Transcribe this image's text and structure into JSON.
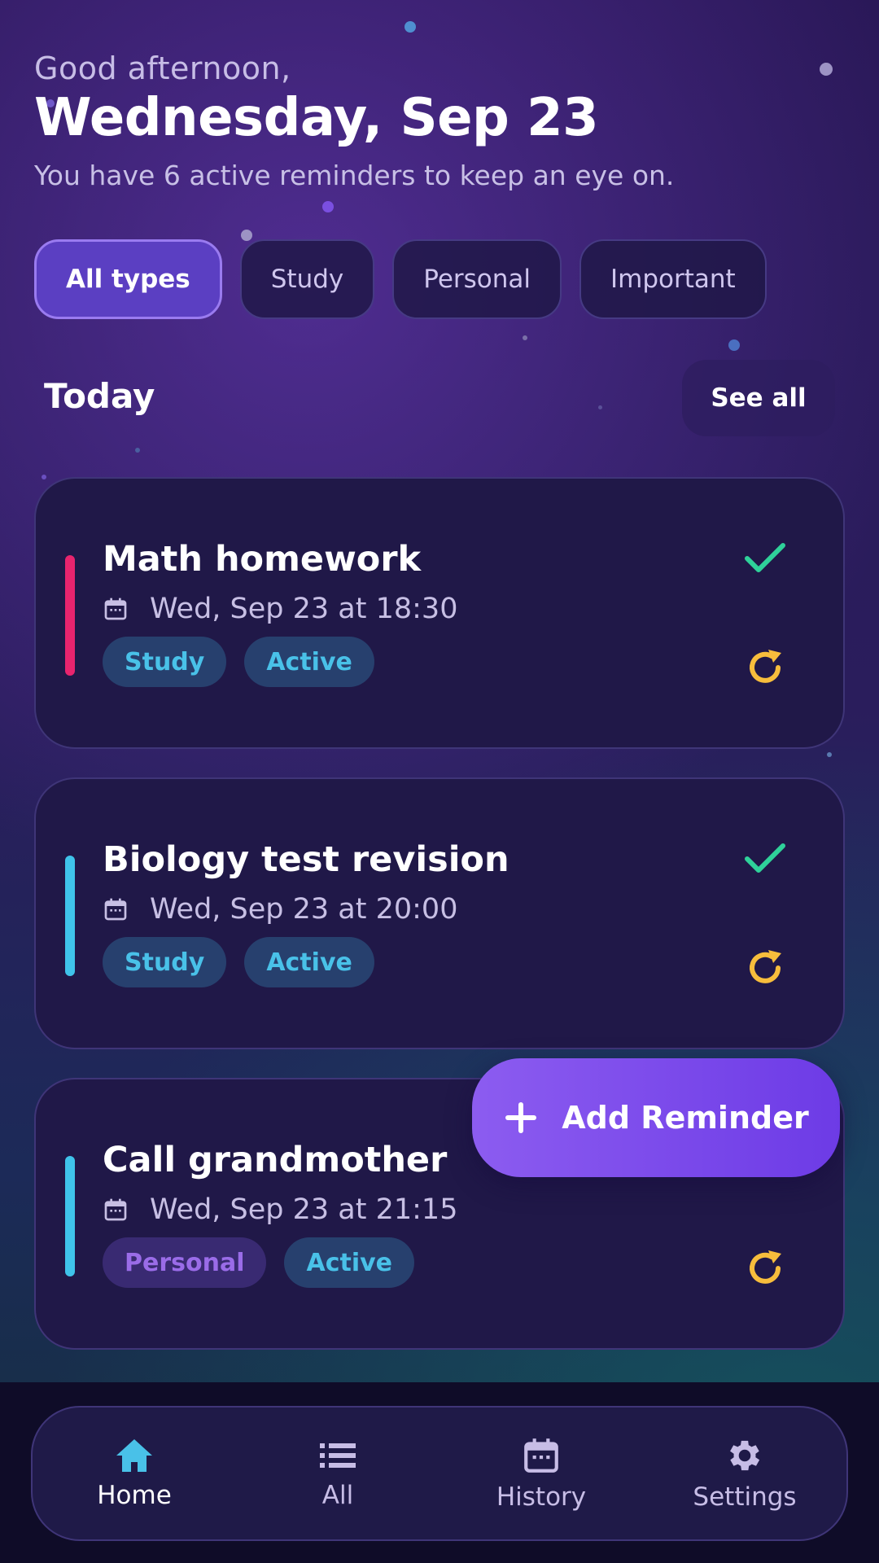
{
  "header": {
    "greeting": "Good afternoon,",
    "date": "Wednesday, Sep 23",
    "subtitle": "You have 6 active reminders to keep an eye on."
  },
  "filters": [
    "All types",
    "Study",
    "Personal",
    "Important"
  ],
  "active_filter": "All types",
  "section": {
    "title": "Today",
    "see_all_label": "See all"
  },
  "reminders": [
    {
      "title": "Math homework",
      "time": "Wed, Sep 23 at 18:30",
      "category": "Study",
      "status": "Active",
      "accent_color": "#e8246e",
      "done_icon": "check-icon",
      "repeat_icon": "refresh-icon"
    },
    {
      "title": "Biology test revision",
      "time": "Wed, Sep 23 at 20:00",
      "category": "Study",
      "status": "Active",
      "accent_color": "#3fc3ea",
      "done_icon": "check-icon",
      "repeat_icon": "refresh-icon"
    },
    {
      "title": "Call grandmother",
      "time": "Wed, Sep 23 at 21:15",
      "category": "Personal",
      "status": "Active",
      "accent_color": "#3fc3ea",
      "repeat_icon": "refresh-icon"
    }
  ],
  "fab": {
    "label": "Add Reminder",
    "icon": "plus-icon"
  },
  "nav": [
    {
      "label": "Home",
      "icon": "home-icon",
      "active": true
    },
    {
      "label": "All",
      "icon": "list-icon",
      "active": false
    },
    {
      "label": "History",
      "icon": "calendar-icon",
      "active": false
    },
    {
      "label": "Settings",
      "icon": "gear-icon",
      "active": false
    }
  ],
  "colors": {
    "check": "#2fd19a",
    "refresh": "#f7bd3c",
    "accent_purple": "#7b4cec",
    "tag_blue_text": "#49c1e8",
    "tag_purple_text": "#9a6ce8"
  }
}
